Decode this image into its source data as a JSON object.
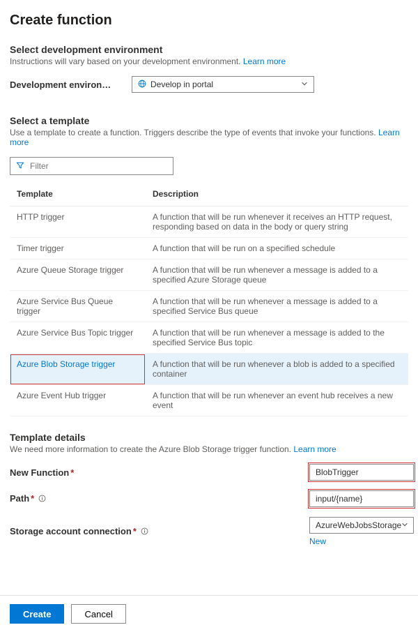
{
  "title": "Create function",
  "section1": {
    "heading": "Select development environment",
    "sub": "Instructions will vary based on your development environment.",
    "learn": "Learn more",
    "field_label": "Development environ…",
    "select_value": "Develop in portal"
  },
  "section2": {
    "heading": "Select a template",
    "sub": "Use a template to create a function. Triggers describe the type of events that invoke your functions.",
    "learn": "Learn more",
    "filter_placeholder": "Filter",
    "col_template": "Template",
    "col_description": "Description",
    "rows": [
      {
        "name": "HTTP trigger",
        "desc": "A function that will be run whenever it receives an HTTP request, responding based on data in the body or query string",
        "selected": false
      },
      {
        "name": "Timer trigger",
        "desc": "A function that will be run on a specified schedule",
        "selected": false
      },
      {
        "name": "Azure Queue Storage trigger",
        "desc": "A function that will be run whenever a message is added to a specified Azure Storage queue",
        "selected": false
      },
      {
        "name": "Azure Service Bus Queue trigger",
        "desc": "A function that will be run whenever a message is added to a specified Service Bus queue",
        "selected": false
      },
      {
        "name": "Azure Service Bus Topic trigger",
        "desc": "A function that will be run whenever a message is added to the specified Service Bus topic",
        "selected": false
      },
      {
        "name": "Azure Blob Storage trigger",
        "desc": "A function that will be run whenever a blob is added to a specified container",
        "selected": true
      },
      {
        "name": "Azure Event Hub trigger",
        "desc": "A function that will be run whenever an event hub receives a new event",
        "selected": false
      }
    ]
  },
  "details": {
    "heading": "Template details",
    "sub": "We need more information to create the Azure Blob Storage trigger function.",
    "learn": "Learn more",
    "new_function_label": "New Function",
    "new_function_value": "BlobTrigger",
    "path_label": "Path",
    "path_value": "input/{name}",
    "conn_label": "Storage account connection",
    "conn_value": "AzureWebJobsStorage",
    "new_link": "New"
  },
  "footer": {
    "create": "Create",
    "cancel": "Cancel"
  }
}
